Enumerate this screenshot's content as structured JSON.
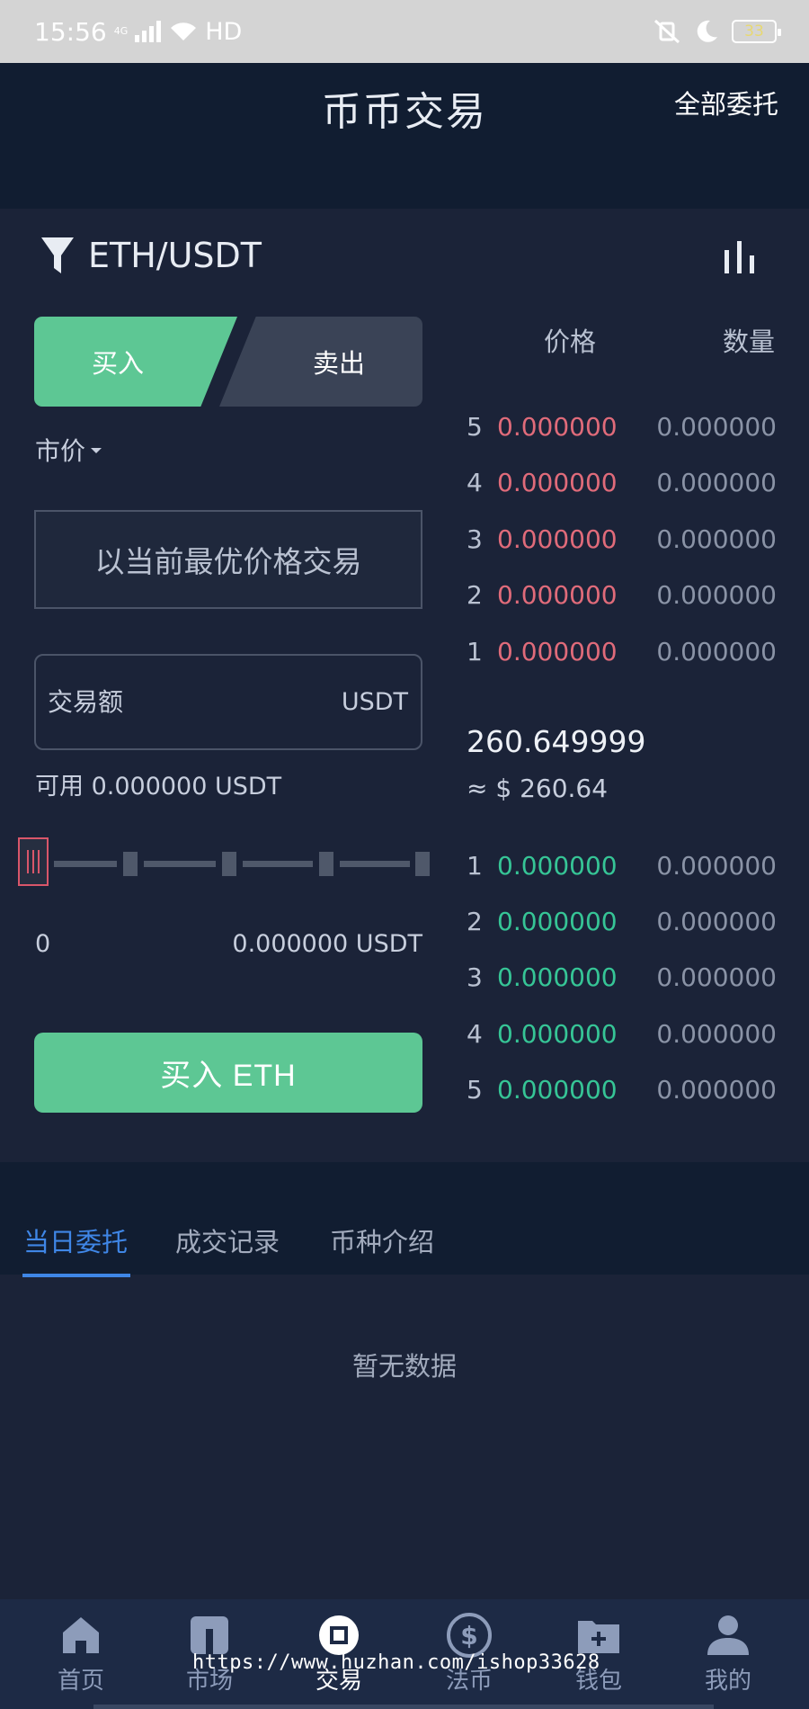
{
  "status_bar": {
    "time": "15:56",
    "network": "4G",
    "hd": "HD",
    "battery": "33"
  },
  "header": {
    "title": "币币交易",
    "action": "全部委托"
  },
  "pair": {
    "name": "ETH/USDT"
  },
  "trade": {
    "buy_tab": "买入",
    "sell_tab": "卖出",
    "price_type": "市价",
    "market_note": "以当前最优价格交易",
    "amount_placeholder": "交易额",
    "amount_unit": "USDT",
    "available": "可用 0.000000 USDT",
    "slider_percent": 0,
    "range_min": "0",
    "range_max": "0.000000 USDT",
    "submit": "买入 ETH"
  },
  "orderbook": {
    "price_header": "价格",
    "qty_header": "数量",
    "asks": [
      {
        "level": "5",
        "price": "0.000000",
        "qty": "0.000000"
      },
      {
        "level": "4",
        "price": "0.000000",
        "qty": "0.000000"
      },
      {
        "level": "3",
        "price": "0.000000",
        "qty": "0.000000"
      },
      {
        "level": "2",
        "price": "0.000000",
        "qty": "0.000000"
      },
      {
        "level": "1",
        "price": "0.000000",
        "qty": "0.000000"
      }
    ],
    "last_price": "260.649999",
    "last_fiat": "≈ $ 260.64",
    "bids": [
      {
        "level": "1",
        "price": "0.000000",
        "qty": "0.000000"
      },
      {
        "level": "2",
        "price": "0.000000",
        "qty": "0.000000"
      },
      {
        "level": "3",
        "price": "0.000000",
        "qty": "0.000000"
      },
      {
        "level": "4",
        "price": "0.000000",
        "qty": "0.000000"
      },
      {
        "level": "5",
        "price": "0.000000",
        "qty": "0.000000"
      }
    ]
  },
  "tabs": [
    "当日委托",
    "成交记录",
    "币种介绍"
  ],
  "empty_text": "暂无数据",
  "nav": [
    {
      "label": "首页",
      "icon": "home-icon"
    },
    {
      "label": "市场",
      "icon": "market-icon"
    },
    {
      "label": "交易",
      "icon": "trade-icon"
    },
    {
      "label": "法币",
      "icon": "dollar-icon"
    },
    {
      "label": "钱包",
      "icon": "wallet-icon"
    },
    {
      "label": "我的",
      "icon": "user-icon"
    }
  ],
  "watermark": "https://www.huzhan.com/ishop33628",
  "colors": {
    "accent_green": "#5dc794",
    "ask_red": "#e06b7a",
    "bid_green": "#36c596",
    "tab_blue": "#3f86e6"
  }
}
